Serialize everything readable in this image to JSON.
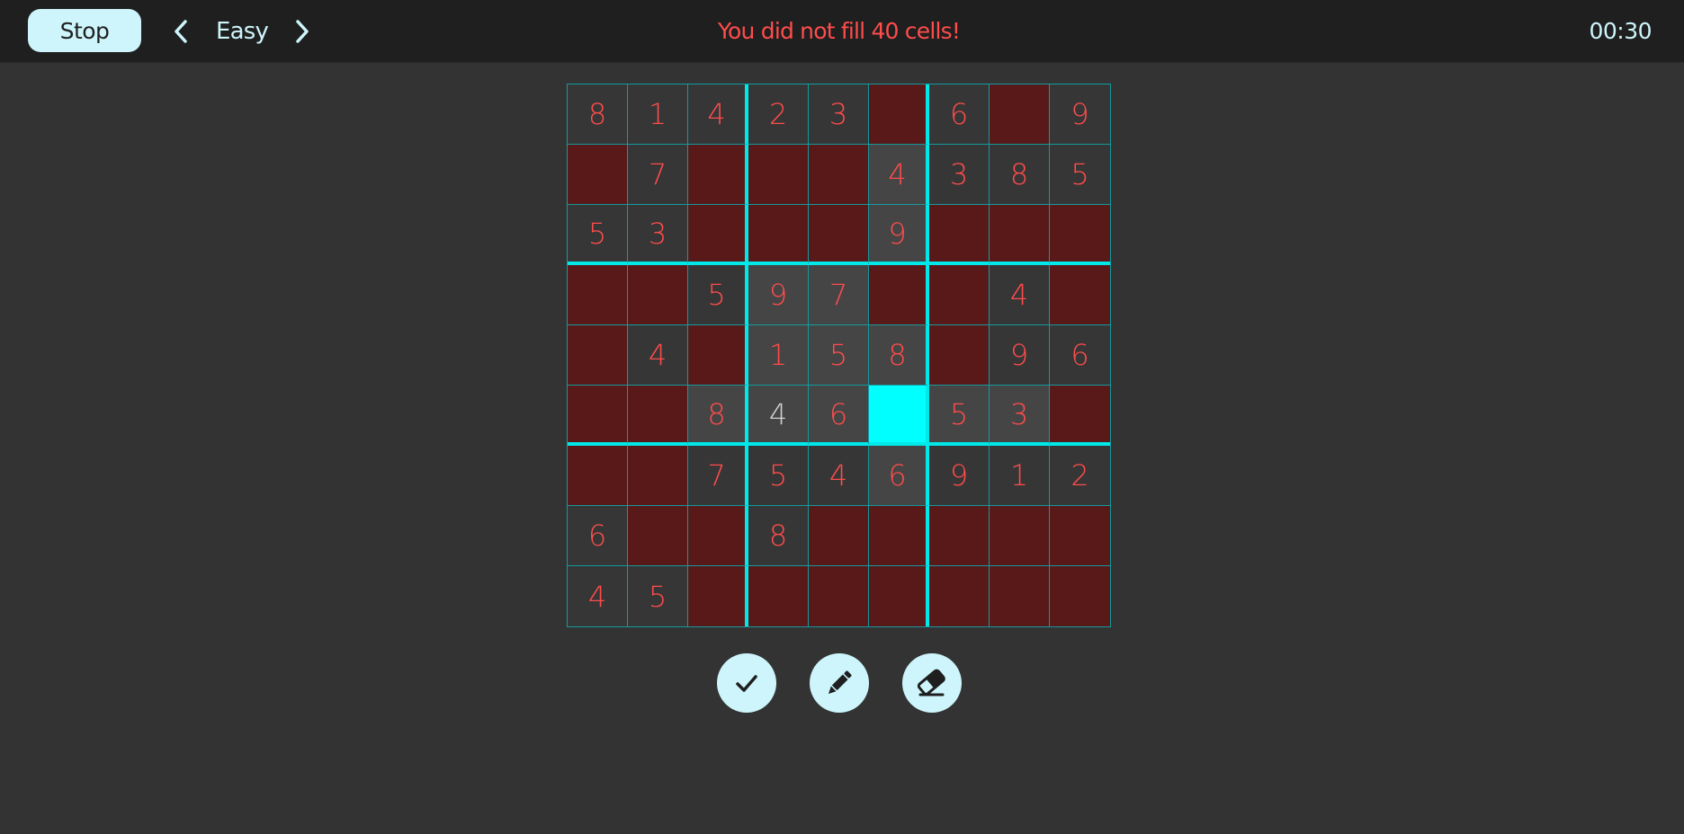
{
  "header": {
    "stop_label": "Stop",
    "prev_icon": "chevron-left-icon",
    "difficulty": "Easy",
    "next_icon": "chevron-right-icon",
    "message": "You did not fill 40 cells!",
    "timer": "00:30"
  },
  "colors": {
    "accent": "#cdf5fb",
    "grid_line": "#00e8e8",
    "error_text": "#ff4c4c",
    "empty_error_cell": "#591919",
    "selected_cell": "#00ffff",
    "entered_value_text": "#d0d0d0"
  },
  "board": {
    "rows": [
      [
        "8",
        "1",
        "4",
        "2",
        "3",
        "",
        "6",
        "",
        "9"
      ],
      [
        "",
        "7",
        "",
        "",
        "",
        "4",
        "3",
        "8",
        "5"
      ],
      [
        "5",
        "3",
        "",
        "",
        "",
        "9",
        "",
        "",
        ""
      ],
      [
        "",
        "",
        "5",
        "9",
        "7",
        "",
        "",
        "4",
        ""
      ],
      [
        "",
        "4",
        "",
        "1",
        "5",
        "8",
        "",
        "9",
        "6"
      ],
      [
        "",
        "",
        "8",
        "4",
        "6",
        "",
        "5",
        "3",
        ""
      ],
      [
        "",
        "",
        "7",
        "5",
        "4",
        "6",
        "9",
        "1",
        "2"
      ],
      [
        "6",
        "",
        "",
        "8",
        "",
        "",
        "",
        "",
        ""
      ],
      [
        "4",
        "5",
        "",
        "",
        "",
        "",
        "",
        "",
        ""
      ]
    ],
    "selected": [
      5,
      5
    ],
    "user_entered": [
      [
        5,
        3
      ]
    ]
  },
  "tools": [
    {
      "name": "check",
      "icon": "check-icon"
    },
    {
      "name": "pencil",
      "icon": "pencil-icon"
    },
    {
      "name": "eraser",
      "icon": "eraser-icon"
    }
  ]
}
